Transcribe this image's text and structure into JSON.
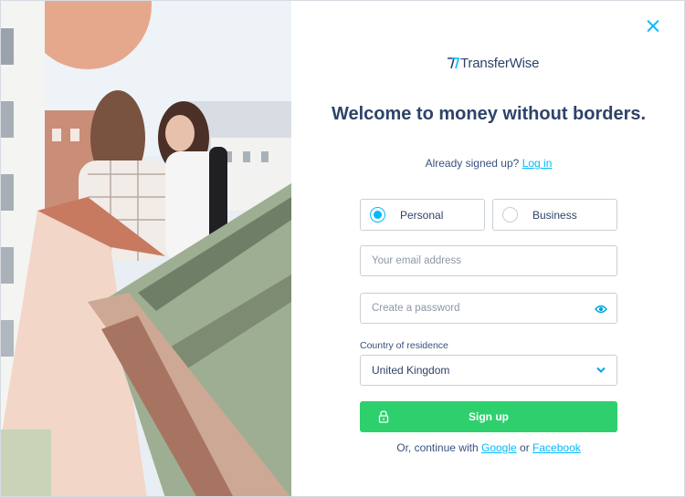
{
  "logo": {
    "text": "TransferWise",
    "icon": "transferwise-flag-icon"
  },
  "title": "Welcome to money without borders.",
  "login_prompt": {
    "text": "Already signed up?",
    "link": "Log in"
  },
  "account_type": {
    "options": [
      {
        "label": "Personal",
        "checked": true
      },
      {
        "label": "Business",
        "checked": false
      }
    ]
  },
  "email": {
    "placeholder": "Your email address",
    "value": ""
  },
  "password": {
    "placeholder": "Create a password",
    "value": "",
    "icon": "eye-icon"
  },
  "country": {
    "label": "Country of residence",
    "value": "United Kingdom",
    "icon": "chevron-down-icon"
  },
  "signup_button": {
    "label": "Sign up",
    "icon": "lock-icon",
    "color": "#2ed06e"
  },
  "social": {
    "prefix": "Or, continue with",
    "google": "Google",
    "separator": "or",
    "facebook": "Facebook"
  },
  "close": {
    "icon": "close-icon"
  },
  "colors": {
    "accent": "#00b9ff",
    "heading": "#2e4369",
    "primary_button": "#2ed06e"
  }
}
